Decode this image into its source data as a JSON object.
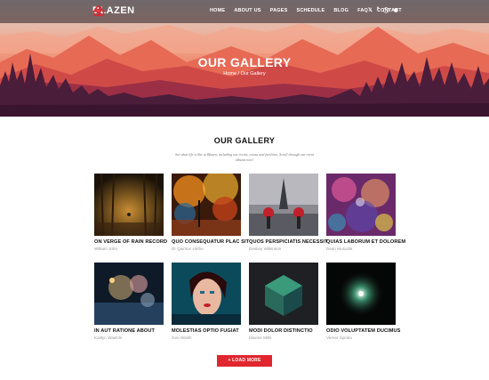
{
  "brand": {
    "name": "BLAZEN",
    "accent": "#e0262e"
  },
  "nav": {
    "items": [
      "HOME",
      "ABOUT US",
      "PAGES",
      "SCHEDULE",
      "BLOG",
      "FAQ",
      "CONTACT"
    ],
    "social_icons": [
      "twitter-icon",
      "facebook-icon",
      "instagram-icon",
      "globe-icon"
    ]
  },
  "hero": {
    "title": "OUR GALLERY",
    "breadcrumb": {
      "home": "Home",
      "separator": " / ",
      "current": "Our Gallery"
    }
  },
  "section": {
    "title": "OUR GALLERY",
    "subtitle": "See what life is like at Blazen, including our events, rooms and facilities. Scroll through our event albums now!"
  },
  "gallery": [
    {
      "title": "ON VERGE OF RAIN RECORD",
      "author": "William John"
    },
    {
      "title": "QUO CONSEQUATUR PLAC SIT",
      "author": "Dr Quinton Hirthe"
    },
    {
      "title": "QUOS PERSPICIATIS NECESSIT",
      "author": "Destiny Wilkinson"
    },
    {
      "title": "QUIAS LABORUM ET DOLOREM",
      "author": "Dean Muraziik"
    },
    {
      "title": "IN AUT RATIONE ABOUT",
      "author": "Kaitlyn Waelchi"
    },
    {
      "title": "MOLESTIAS OPTIO FUGIAT",
      "author": "Geo Walsh"
    },
    {
      "title": "MODI DOLOR DISTINCTIO",
      "author": "Maxine Mills"
    },
    {
      "title": "ODIO VOLUPTATEM DUCIMUS",
      "author": "Verner Spinka"
    }
  ],
  "load_more": "+ LOAD MORE"
}
